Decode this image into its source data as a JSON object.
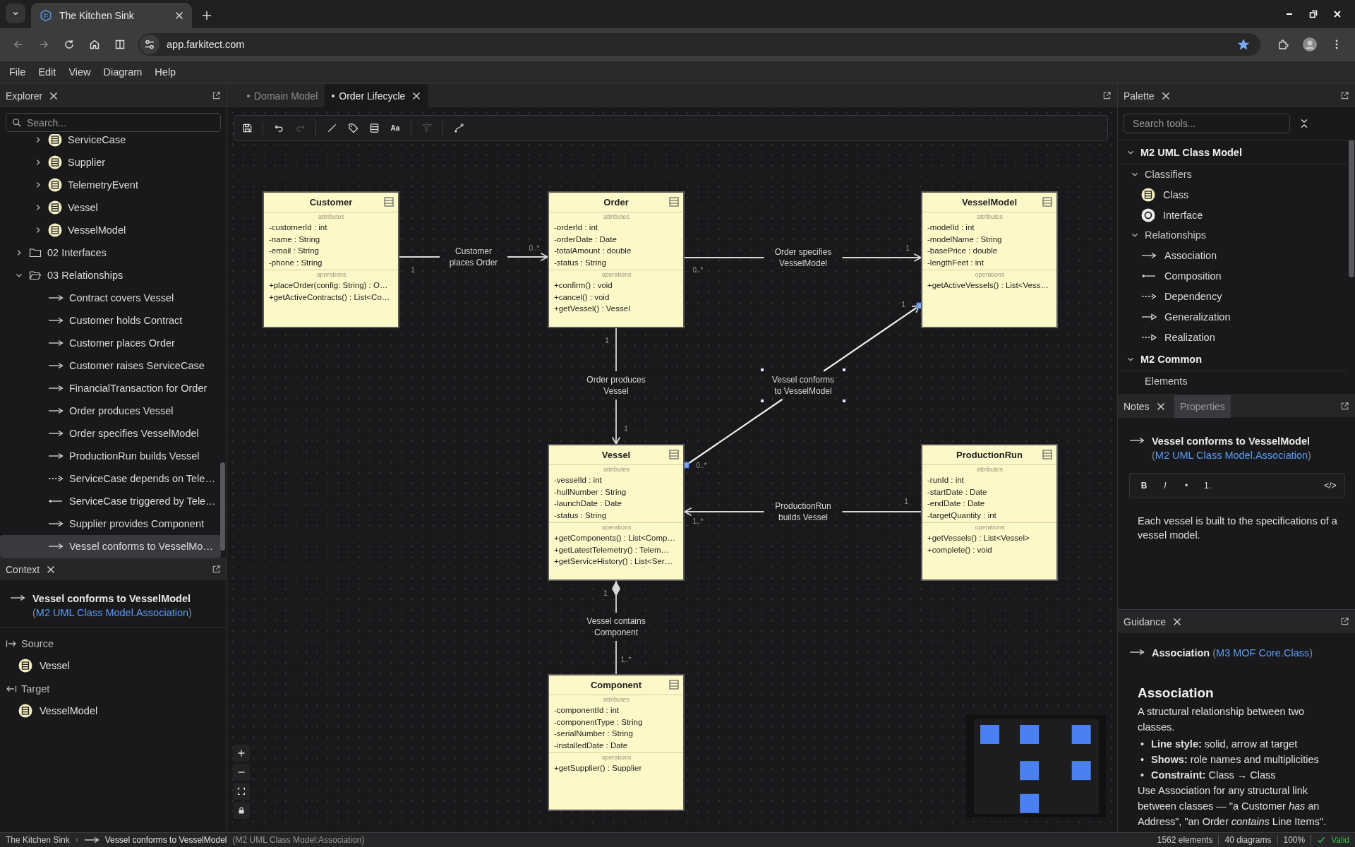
{
  "browser": {
    "favicon_letter": "F",
    "tab_title": "The Kitchen Sink",
    "url": "app.farkitect.com",
    "bookmarked": true
  },
  "menu": [
    "File",
    "Edit",
    "View",
    "Diagram",
    "Help"
  ],
  "explorer": {
    "title": "Explorer",
    "search_placeholder": "Search...",
    "tree": [
      {
        "children": [
          {
            "label": "ServiceCase",
            "kind": "class",
            "expanded": false,
            "selected": false
          },
          {
            "label": "Supplier",
            "kind": "class",
            "expanded": false,
            "selected": false
          },
          {
            "label": "TelemetryEvent",
            "kind": "class",
            "expanded": false,
            "selected": false
          },
          {
            "label": "Vessel",
            "kind": "class",
            "expanded": false,
            "selected": false
          },
          {
            "label": "VesselModel",
            "kind": "class",
            "expanded": false,
            "selected": false
          }
        ]
      },
      {
        "label": "02 Interfaces",
        "kind": "folder",
        "expanded": false,
        "selected": false
      },
      {
        "label": "03 Relationships",
        "kind": "folder",
        "expanded": true,
        "selected": false,
        "children": [
          {
            "label": "Contract covers Vessel",
            "kind": "association",
            "selected": false
          },
          {
            "label": "Customer holds Contract",
            "kind": "association",
            "selected": false
          },
          {
            "label": "Customer places Order",
            "kind": "association",
            "selected": false
          },
          {
            "label": "Customer raises ServiceCase",
            "kind": "association",
            "selected": false
          },
          {
            "label": "FinancialTransaction for Order",
            "kind": "association",
            "selected": false
          },
          {
            "label": "Order produces Vessel",
            "kind": "association",
            "selected": false
          },
          {
            "label": "Order specifies VesselModel",
            "kind": "association",
            "selected": false
          },
          {
            "label": "ProductionRun builds Vessel",
            "kind": "association",
            "selected": false
          },
          {
            "label": "ServiceCase depends on Tele…",
            "kind": "dependency",
            "selected": false
          },
          {
            "label": "ServiceCase triggered by Tele…",
            "kind": "composition",
            "selected": false
          },
          {
            "label": "Supplier provides Component",
            "kind": "association",
            "selected": false
          },
          {
            "label": "Vessel conforms to VesselMo…",
            "kind": "association",
            "selected": true
          }
        ]
      }
    ]
  },
  "context": {
    "title": "Context",
    "element": {
      "kind": "association",
      "name": "Vessel conforms to VesselModel",
      "type_prefix": "(",
      "type": "M2 UML Class Model.Association",
      "type_suffix": ")"
    },
    "source_label": "Source",
    "source": "Vessel",
    "target_label": "Target",
    "target": "VesselModel"
  },
  "editor": {
    "tabs": [
      {
        "label": "Domain Model",
        "selected": false
      },
      {
        "label": "Order Lifecycle",
        "selected": true
      }
    ],
    "toolbar": [
      [
        {
          "kind": "save",
          "disabled": false
        }
      ],
      [
        {
          "kind": "undo",
          "disabled": false
        },
        {
          "kind": "redo",
          "disabled": true
        }
      ],
      [
        {
          "kind": "line",
          "disabled": false
        },
        {
          "kind": "tag",
          "disabled": false
        },
        {
          "kind": "compartments",
          "disabled": false
        },
        {
          "kind": "text-style",
          "glyph": "Aa",
          "disabled": false
        }
      ],
      [
        {
          "kind": "clear-filter",
          "disabled": true
        }
      ],
      [
        {
          "kind": "route",
          "disabled": false
        }
      ]
    ]
  },
  "diagram": {
    "classes": [
      {
        "name": "Customer",
        "sections": [
          {
            "label": "attributes",
            "items": [
              "-customerId : int",
              "-name : String",
              "-email : String",
              "-phone : String"
            ]
          },
          {
            "label": "operations",
            "items": [
              "+placeOrder(config: String) : O…",
              "+getActiveContracts() : List<Co…"
            ]
          }
        ]
      },
      {
        "name": "Order",
        "sections": [
          {
            "label": "attributes",
            "items": [
              "-orderId : int",
              "-orderDate : Date",
              "-totalAmount : double",
              "-status : String"
            ]
          },
          {
            "label": "operations",
            "items": [
              "+confirm() : void",
              "+cancel() : void",
              "+getVessel() : Vessel"
            ]
          }
        ]
      },
      {
        "name": "VesselModel",
        "sections": [
          {
            "label": "attributes",
            "items": [
              "-modelId : int",
              "-modelName : String",
              "-basePrice : double",
              "-lengthFeet : int"
            ]
          },
          {
            "label": "operations",
            "items": [
              "+getActiveVessels() : List<Vess…"
            ]
          }
        ]
      },
      {
        "name": "Vessel",
        "sections": [
          {
            "label": "attributes",
            "items": [
              "-vesselId : int",
              "-hullNumber : String",
              "-launchDate : Date",
              "-status : String"
            ]
          },
          {
            "label": "operations",
            "items": [
              "+getComponents() : List<Comp…",
              "+getLatestTelemetry() : Telem…",
              "+getServiceHistory() : List<Ser…"
            ]
          }
        ]
      },
      {
        "name": "ProductionRun",
        "sections": [
          {
            "label": "attributes",
            "items": [
              "-runId : int",
              "-startDate : Date",
              "-endDate : Date",
              "-targetQuantity : int"
            ]
          },
          {
            "label": "operations",
            "items": [
              "+getVessels() : List<Vessel>",
              "+complete() : void"
            ]
          }
        ]
      },
      {
        "name": "Component",
        "sections": [
          {
            "label": "attributes",
            "items": [
              "-componentId : int",
              "-componentType : String",
              "-serialNumber : String",
              "-installedDate : Date"
            ]
          },
          {
            "label": "operations",
            "items": [
              "+getSupplier() : Supplier"
            ]
          }
        ]
      }
    ],
    "links": [
      {
        "kind": "association",
        "label": "Customer places Order",
        "source_multiplicity": "1",
        "target_multiplicity": "0..*",
        "selected": false
      },
      {
        "kind": "association",
        "label": "Order specifies VesselModel",
        "source_multiplicity": "0..*",
        "target_multiplicity": "1",
        "selected": false
      },
      {
        "kind": "association",
        "label": "Order produces Vessel",
        "source_multiplicity": "1",
        "target_multiplicity": "1",
        "selected": false
      },
      {
        "kind": "association",
        "label": "Vessel conforms to VesselModel",
        "source_multiplicity": "0..*",
        "target_multiplicity": "1",
        "selected": true
      },
      {
        "kind": "association",
        "label": "ProductionRun builds Vessel",
        "source_multiplicity": "1",
        "target_multiplicity": "1..*",
        "selected": false
      },
      {
        "kind": "composition",
        "label": "Vessel contains Component",
        "source_multiplicity": "1",
        "target_multiplicity": "1..*",
        "selected": false
      }
    ]
  },
  "palette": {
    "title": "Palette",
    "search_placeholder": "Search tools...",
    "sections": [
      {
        "title": "M2 UML Class Model",
        "expanded": true,
        "groups": [
          {
            "title": "Classifiers",
            "expanded": true,
            "items": [
              {
                "label": "Class",
                "kind": "class"
              },
              {
                "label": "Interface",
                "kind": "interface"
              }
            ]
          },
          {
            "title": "Relationships",
            "expanded": true,
            "items": [
              {
                "label": "Association",
                "kind": "association"
              },
              {
                "label": "Composition",
                "kind": "composition"
              },
              {
                "label": "Dependency",
                "kind": "dependency"
              },
              {
                "label": "Generalization",
                "kind": "generalization"
              },
              {
                "label": "Realization",
                "kind": "realization"
              }
            ]
          }
        ]
      },
      {
        "title": "M2 Common",
        "expanded": true,
        "groups": [
          {
            "title": "Elements"
          }
        ]
      }
    ]
  },
  "notes": {
    "tabs": [
      {
        "label": "Notes",
        "selected": true
      },
      {
        "label": "Properties",
        "selected": false
      }
    ],
    "element": {
      "kind": "association",
      "name": "Vessel conforms to VesselModel",
      "type_prefix": "(",
      "type": "M2 UML Class Model.Association",
      "type_suffix": ")"
    },
    "format_tools": [
      {
        "kind": "bold",
        "label": "B"
      },
      {
        "kind": "italic",
        "label": "I"
      },
      {
        "kind": "bullet-list",
        "label": "•"
      },
      {
        "kind": "numbered-list",
        "label": "1."
      },
      {
        "kind": "code",
        "label": "</>"
      }
    ],
    "text": "Each vessel is built to the specifications of a vessel model."
  },
  "guidance": {
    "title": "Guidance",
    "element": {
      "kind": "association",
      "name": "Association",
      "type_prefix": "(",
      "type": "M3 MOF Core.Class",
      "type_suffix": ")"
    },
    "heading": "Association",
    "intro": "A structural relationship between two classes.",
    "bullets": [
      {
        "marker": "•",
        "text": "**Line style:** solid, arrow at target"
      },
      {
        "marker": "•",
        "text": "**Shows:** role names and multiplicities"
      },
      {
        "marker": "•",
        "text": "**Constraint:** Class → Class"
      }
    ],
    "body": "Use Association for any structural link between classes — \"a Customer *has* an Address\", \"an Order *contains* Line Items\"."
  },
  "status_bar": {
    "project": "The Kitchen Sink",
    "separator": "›",
    "selection": "Vessel conforms to VesselModel",
    "selection_type": "(M2 UML Class Model:Association)",
    "stats": [
      "1562 elements",
      "40 diagrams",
      "100%"
    ],
    "validation": "Valid",
    "valid": true
  }
}
